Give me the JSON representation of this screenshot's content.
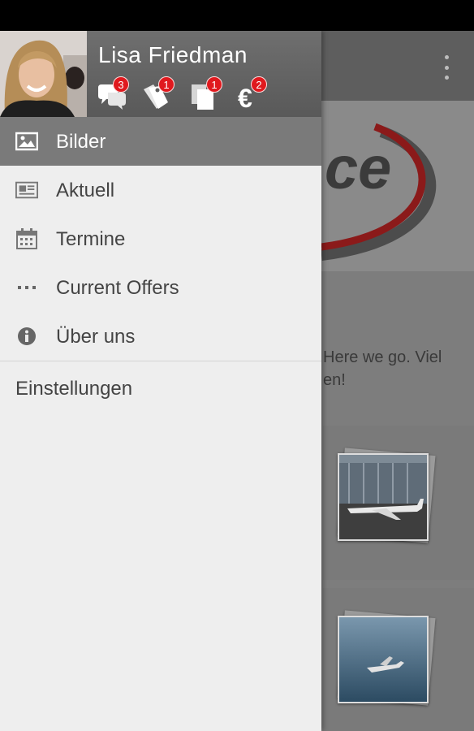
{
  "user": {
    "name": "Lisa Friedman"
  },
  "header_icons": [
    {
      "icon": "chat-bubbles-icon",
      "badge": "3"
    },
    {
      "icon": "tags-icon",
      "badge": "1"
    },
    {
      "icon": "documents-icon",
      "badge": "1"
    },
    {
      "icon": "euro-icon",
      "badge": "2"
    }
  ],
  "menu": [
    {
      "label": "Bilder",
      "icon": "image-icon",
      "active": true
    },
    {
      "label": "Aktuell",
      "icon": "newspaper-icon",
      "active": false
    },
    {
      "label": "Termine",
      "icon": "calendar-icon",
      "active": false
    },
    {
      "label": "Current Offers",
      "icon": "more-dots-icon",
      "active": false
    },
    {
      "label": "Über uns",
      "icon": "info-icon",
      "active": false
    }
  ],
  "settings": {
    "label": "Einstellungen"
  },
  "background": {
    "logo_text": "ce",
    "text_line1": "Here we go. Viel",
    "text_line2": "en!"
  },
  "colors": {
    "badge": "#e0191e",
    "drawer_bg": "#eeeeee",
    "header_bg": "#666666",
    "active_item_bg": "#7a7a7a",
    "logo_swoosh": "#8b1a1a"
  }
}
